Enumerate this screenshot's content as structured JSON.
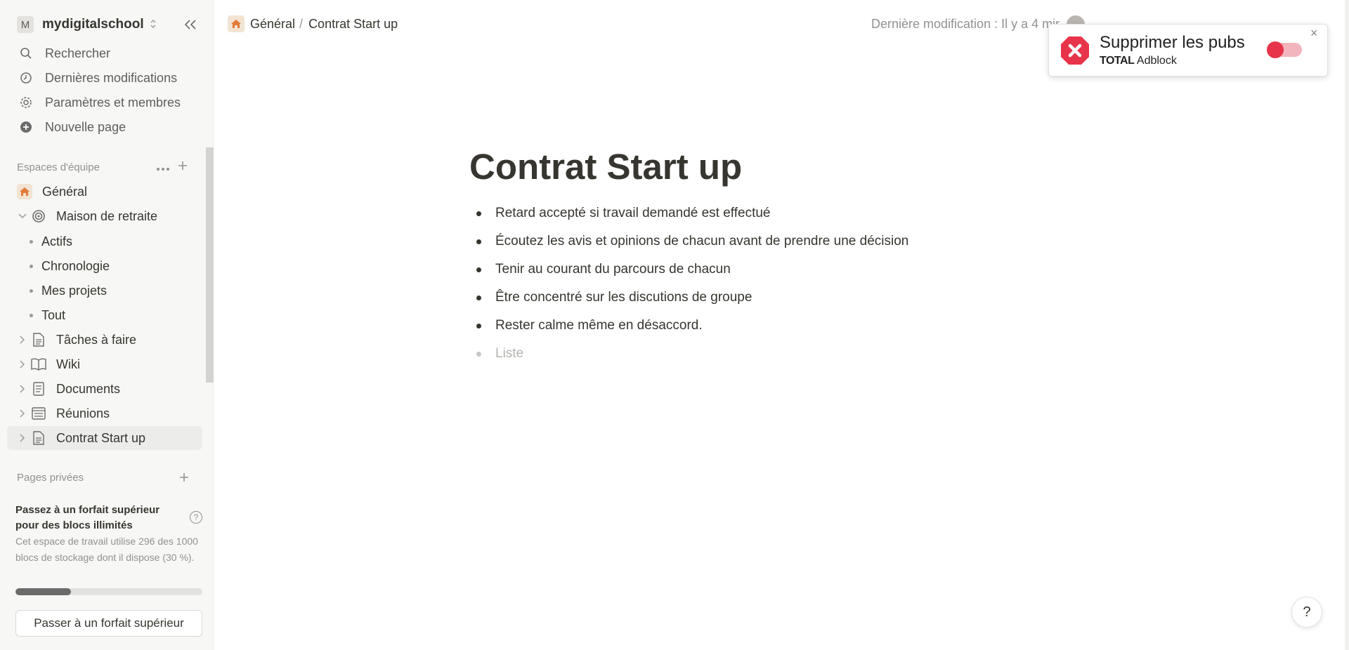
{
  "workspace": {
    "initial": "M",
    "name": "mydigitalschool"
  },
  "nav": [
    {
      "label": "Rechercher",
      "icon": "search-icon"
    },
    {
      "label": "Dernières modifications",
      "icon": "clock-icon"
    },
    {
      "label": "Paramètres et membres",
      "icon": "gear-icon"
    },
    {
      "label": "Nouvelle page",
      "icon": "plus-circle-icon"
    }
  ],
  "team_section": {
    "label": "Espaces d'équipe"
  },
  "tree": {
    "general": "Général",
    "maison": "Maison de retraite",
    "sub": [
      "Actifs",
      "Chronologie",
      "Mes projets",
      "Tout"
    ],
    "taches": "Tâches à faire",
    "wiki": "Wiki",
    "documents": "Documents",
    "reunions": "Réunions",
    "contrat": "Contrat Start up"
  },
  "private_section": {
    "label": "Pages privées"
  },
  "upgrade": {
    "title": "Passez à un forfait supérieur pour des blocs illimités",
    "description": "Cet espace de travail utilise 296 des 1000 blocs de stockage dont il dispose (30 %).",
    "usage_fraction": 0.296,
    "button": "Passer à un forfait supérieur",
    "help": "?"
  },
  "breadcrumb": {
    "parent": "Général",
    "separator": "/",
    "current": "Contrat Start up"
  },
  "last_edit": "Dernière modification : Il y a 4 min",
  "adblock": {
    "title": "Supprimer les pubs",
    "brand_bold": "TOTAL",
    "brand_rest": "Adblock",
    "toggle_on": false,
    "close": "×"
  },
  "page": {
    "title": "Contrat Start up",
    "bullets": [
      "Retard accepté si travail demandé est effectué",
      "Écoutez les avis et opinions de chacun avant de prendre une décision",
      "Tenir au courant du parcours de chacun",
      "Être concentré sur les discutions de groupe",
      "Rester calme même en désaccord."
    ],
    "placeholder": "Liste"
  },
  "help_button": "?",
  "colors": {
    "accent_orange": "#e07b39",
    "adblock_red": "#e8344a",
    "text": "#37352f",
    "muted": "#91918e"
  }
}
